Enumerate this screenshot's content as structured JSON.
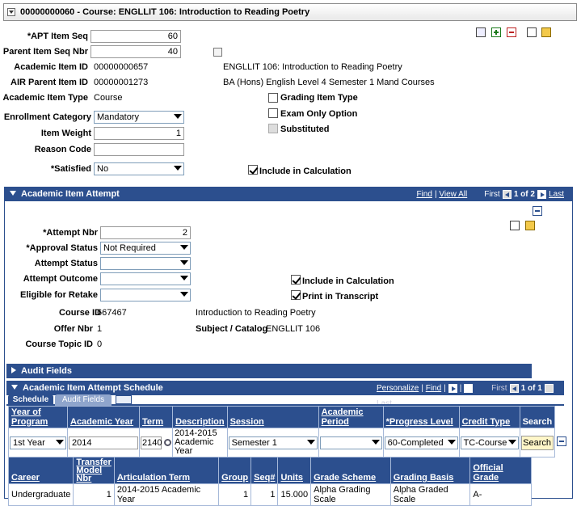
{
  "course_header": {
    "title": "00000000060 - Course: ENGLLIT 106: Introduction to Reading Poetry"
  },
  "item": {
    "apt_item_seq": {
      "label": "*APT Item Seq",
      "value": "60"
    },
    "parent_item_seq": {
      "label": "Parent Item Seq Nbr",
      "value": "40"
    },
    "academic_item_id": {
      "label": "Academic Item ID",
      "value": "00000000657",
      "desc": "ENGLLIT  106: Introduction to Reading Poetry"
    },
    "air_parent_item_id": {
      "label": "AIR Parent Item ID",
      "value": "00000001273",
      "desc": "BA (Hons) English Level 4 Semester 1 Mand Courses"
    },
    "academic_item_type": {
      "label": "Academic Item Type",
      "value": "Course"
    },
    "grading_item_type": "Grading Item Type",
    "exam_only_option": "Exam Only Option",
    "substituted": "Substituted",
    "enrollment_category": {
      "label": "Enrollment Category",
      "value": "Mandatory"
    },
    "item_weight": {
      "label": "Item Weight",
      "value": "1"
    },
    "reason_code": {
      "label": "Reason Code",
      "value": ""
    },
    "satisfied": {
      "label": "*Satisfied",
      "value": "No"
    },
    "include_in_calculation": "Include in Calculation"
  },
  "attempt_section": {
    "title": "Academic Item Attempt",
    "find": "Find",
    "view_all": "View All",
    "first": "First",
    "count": "1 of 2",
    "last": "Last"
  },
  "attempt": {
    "attempt_nbr": {
      "label": "*Attempt Nbr",
      "value": "2"
    },
    "approval_status": {
      "label": "*Approval Status",
      "value": "Not Required"
    },
    "attempt_status": {
      "label": "Attempt Status",
      "value": ""
    },
    "attempt_outcome": {
      "label": "Attempt Outcome",
      "value": ""
    },
    "eligible_for_retake": {
      "label": "Eligible for Retake",
      "value": ""
    },
    "include_in_calculation": "Include in Calculation",
    "print_in_transcript": "Print in Transcript",
    "course_id": {
      "label": "Course ID",
      "value": "667467",
      "desc": "Introduction to Reading Poetry"
    },
    "offer_nbr": {
      "label": "Offer Nbr",
      "value": "1"
    },
    "subject_catalog": {
      "label": "Subject / Catalog",
      "value": "ENGLLIT  106"
    },
    "course_topic_id": {
      "label": "Course Topic ID",
      "value": "0"
    }
  },
  "audit_fields": {
    "title": "Audit Fields"
  },
  "schedule": {
    "title": "Academic Item Attempt Schedule",
    "personalize": "Personalize",
    "find": "Find",
    "first": "First",
    "count": "1 of 1",
    "last": "Last",
    "tabs": [
      "Schedule",
      "Audit Fields"
    ],
    "columns": [
      "Year of Program",
      "Academic Year",
      "Term",
      "Description",
      "Session",
      "Academic Period",
      "*Progress Level",
      "Credit Type",
      "Search"
    ],
    "row": {
      "year_of_program": "1st Year",
      "academic_year": "2014",
      "term": "2140",
      "description": "2014-2015 Academic Year",
      "session": "Semester 1",
      "academic_period": "",
      "progress_level": "60-Completed",
      "credit_type": "TC-Course",
      "search_button": "Search"
    }
  },
  "articulation": {
    "columns": [
      "Career",
      "Transfer Model Nbr",
      "Articulation Term",
      "Group",
      "Seq#",
      "Units",
      "Grade Scheme",
      "Grading Basis",
      "Official Grade"
    ],
    "rows": [
      [
        "Undergraduate",
        "1",
        "2014-2015 Academic Year",
        "1",
        "1",
        "15.000",
        "Alpha Grading Scale",
        "Alpha Graded Scale",
        "A-"
      ]
    ]
  },
  "colors": {
    "header_blue": "#2c4f8e",
    "grid_border": "#a5b8d8",
    "search_button": "#fff6c8"
  }
}
